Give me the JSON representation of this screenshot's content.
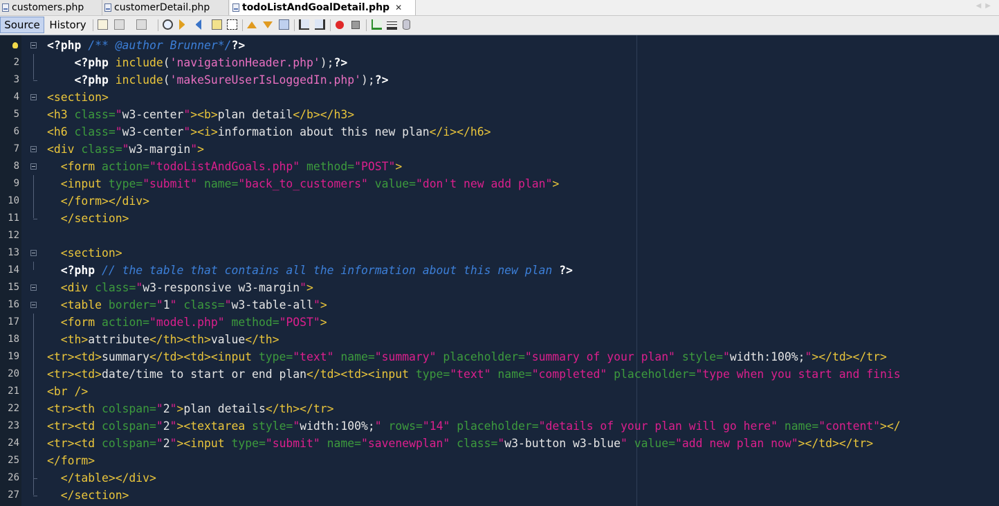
{
  "tabs": [
    {
      "label": "customers.php",
      "active": false
    },
    {
      "label": "customerDetail.php",
      "active": false
    },
    {
      "label": "todoListAndGoalDetail.php",
      "active": true
    }
  ],
  "toolbar": {
    "source_label": "Source",
    "history_label": "History",
    "icons": [
      "last-edit-icon",
      "back-icon",
      "forward-icon",
      "find-selection-icon",
      "find-previous-icon",
      "find-next-icon",
      "toggle-highlight-icon",
      "toggle-rect-select-icon",
      "previous-bookmark-icon",
      "next-bookmark-icon",
      "toggle-bookmark-icon",
      "shift-left-icon",
      "shift-right-icon",
      "start-macro-icon",
      "stop-macro-icon",
      "comment-icon",
      "uncomment-icon",
      "database-icon"
    ]
  },
  "editor": {
    "line_numbers": [
      "1",
      "2",
      "3",
      "4",
      "5",
      "6",
      "7",
      "8",
      "9",
      "10",
      "11",
      "12",
      "13",
      "14",
      "15",
      "16",
      "17",
      "18",
      "19",
      "20",
      "21",
      "22",
      "23",
      "24",
      "25",
      "26",
      "27"
    ],
    "lines": [
      [
        {
          "c": "kw",
          "t": "<?php"
        },
        {
          "c": "tx",
          "t": " "
        },
        {
          "c": "cm",
          "t": "/** @author Brunner*/"
        },
        {
          "c": "kw",
          "t": "?>"
        }
      ],
      [
        {
          "c": "tx",
          "t": "    "
        },
        {
          "c": "kw",
          "t": "<?php"
        },
        {
          "c": "tx",
          "t": " "
        },
        {
          "c": "fn",
          "t": "include"
        },
        {
          "c": "tx",
          "t": "("
        },
        {
          "c": "str",
          "t": "'navigationHeader.php'"
        },
        {
          "c": "tx",
          "t": ");"
        },
        {
          "c": "kw",
          "t": "?>"
        }
      ],
      [
        {
          "c": "tx",
          "t": "    "
        },
        {
          "c": "kw",
          "t": "<?php"
        },
        {
          "c": "tx",
          "t": " "
        },
        {
          "c": "fn",
          "t": "include"
        },
        {
          "c": "tx",
          "t": "("
        },
        {
          "c": "str",
          "t": "'makeSureUserIsLoggedIn.php'"
        },
        {
          "c": "tx",
          "t": ");"
        },
        {
          "c": "kw",
          "t": "?>"
        }
      ],
      [
        {
          "c": "tag",
          "t": "<section>"
        }
      ],
      [
        {
          "c": "tag",
          "t": "<h3"
        },
        {
          "c": "tx",
          "t": " "
        },
        {
          "c": "attr",
          "t": "class="
        },
        {
          "c": "val",
          "t": "\""
        },
        {
          "c": "tx",
          "t": "w3-center"
        },
        {
          "c": "val",
          "t": "\""
        },
        {
          "c": "tag",
          "t": "><b>"
        },
        {
          "c": "tx",
          "t": "plan detail"
        },
        {
          "c": "tag",
          "t": "</b></h3>"
        }
      ],
      [
        {
          "c": "tag",
          "t": "<h6"
        },
        {
          "c": "tx",
          "t": " "
        },
        {
          "c": "attr",
          "t": "class="
        },
        {
          "c": "val",
          "t": "\""
        },
        {
          "c": "tx",
          "t": "w3-center"
        },
        {
          "c": "val",
          "t": "\""
        },
        {
          "c": "tag",
          "t": "><i>"
        },
        {
          "c": "tx",
          "t": "information about this new plan"
        },
        {
          "c": "tag",
          "t": "</i></h6>"
        }
      ],
      [
        {
          "c": "tag",
          "t": "<div"
        },
        {
          "c": "tx",
          "t": " "
        },
        {
          "c": "attr",
          "t": "class="
        },
        {
          "c": "val",
          "t": "\""
        },
        {
          "c": "tx",
          "t": "w3-margin"
        },
        {
          "c": "val",
          "t": "\""
        },
        {
          "c": "tag",
          "t": ">"
        }
      ],
      [
        {
          "c": "tx",
          "t": "  "
        },
        {
          "c": "tag",
          "t": "<form"
        },
        {
          "c": "tx",
          "t": " "
        },
        {
          "c": "attr",
          "t": "action="
        },
        {
          "c": "val",
          "t": "\"todoListAndGoals.php\""
        },
        {
          "c": "tx",
          "t": " "
        },
        {
          "c": "attr",
          "t": "method="
        },
        {
          "c": "val",
          "t": "\"POST\""
        },
        {
          "c": "tag",
          "t": ">"
        }
      ],
      [
        {
          "c": "tx",
          "t": "  "
        },
        {
          "c": "tag",
          "t": "<input"
        },
        {
          "c": "tx",
          "t": " "
        },
        {
          "c": "attr",
          "t": "type="
        },
        {
          "c": "val",
          "t": "\"submit\""
        },
        {
          "c": "tx",
          "t": " "
        },
        {
          "c": "attr",
          "t": "name="
        },
        {
          "c": "val",
          "t": "\"back_to_customers\""
        },
        {
          "c": "tx",
          "t": " "
        },
        {
          "c": "attr",
          "t": "value="
        },
        {
          "c": "val",
          "t": "\"don't new add plan\""
        },
        {
          "c": "tag",
          "t": ">"
        }
      ],
      [
        {
          "c": "tx",
          "t": "  "
        },
        {
          "c": "tag",
          "t": "</form></div>"
        }
      ],
      [
        {
          "c": "tx",
          "t": "  "
        },
        {
          "c": "tag",
          "t": "</section>"
        }
      ],
      [],
      [
        {
          "c": "tx",
          "t": "  "
        },
        {
          "c": "tag",
          "t": "<section>"
        }
      ],
      [
        {
          "c": "tx",
          "t": "  "
        },
        {
          "c": "kw",
          "t": "<?php"
        },
        {
          "c": "tx",
          "t": " "
        },
        {
          "c": "cm",
          "t": "// the table that contains all the information about this new plan"
        },
        {
          "c": "tx",
          "t": " "
        },
        {
          "c": "kw",
          "t": "?>"
        }
      ],
      [
        {
          "c": "tx",
          "t": "  "
        },
        {
          "c": "tag",
          "t": "<div"
        },
        {
          "c": "tx",
          "t": " "
        },
        {
          "c": "attr",
          "t": "class="
        },
        {
          "c": "val",
          "t": "\""
        },
        {
          "c": "tx",
          "t": "w3-responsive w3-margin"
        },
        {
          "c": "val",
          "t": "\""
        },
        {
          "c": "tag",
          "t": ">"
        }
      ],
      [
        {
          "c": "tx",
          "t": "  "
        },
        {
          "c": "tag",
          "t": "<table"
        },
        {
          "c": "tx",
          "t": " "
        },
        {
          "c": "attr",
          "t": "border="
        },
        {
          "c": "val",
          "t": "\""
        },
        {
          "c": "tx",
          "t": "1"
        },
        {
          "c": "val",
          "t": "\""
        },
        {
          "c": "tx",
          "t": " "
        },
        {
          "c": "attr",
          "t": "class="
        },
        {
          "c": "val",
          "t": "\""
        },
        {
          "c": "tx",
          "t": "w3-table-all"
        },
        {
          "c": "val",
          "t": "\""
        },
        {
          "c": "tag",
          "t": ">"
        }
      ],
      [
        {
          "c": "tx",
          "t": "  "
        },
        {
          "c": "tag",
          "t": "<form"
        },
        {
          "c": "tx",
          "t": " "
        },
        {
          "c": "attr",
          "t": "action="
        },
        {
          "c": "val",
          "t": "\"model.php\""
        },
        {
          "c": "tx",
          "t": " "
        },
        {
          "c": "attr",
          "t": "method="
        },
        {
          "c": "val",
          "t": "\"POST\""
        },
        {
          "c": "tag",
          "t": ">"
        }
      ],
      [
        {
          "c": "tx",
          "t": "  "
        },
        {
          "c": "tag",
          "t": "<th>"
        },
        {
          "c": "tx",
          "t": "attribute"
        },
        {
          "c": "tag",
          "t": "</th><th>"
        },
        {
          "c": "tx",
          "t": "value"
        },
        {
          "c": "tag",
          "t": "</th>"
        }
      ],
      [
        {
          "c": "tag",
          "t": "<tr><td>"
        },
        {
          "c": "tx",
          "t": "summary"
        },
        {
          "c": "tag",
          "t": "</td><td><input"
        },
        {
          "c": "tx",
          "t": " "
        },
        {
          "c": "attr",
          "t": "type="
        },
        {
          "c": "val",
          "t": "\"text\""
        },
        {
          "c": "tx",
          "t": " "
        },
        {
          "c": "attr",
          "t": "name="
        },
        {
          "c": "val",
          "t": "\"summary\""
        },
        {
          "c": "tx",
          "t": " "
        },
        {
          "c": "attr",
          "t": "placeholder="
        },
        {
          "c": "val",
          "t": "\"summary of your plan\""
        },
        {
          "c": "tx",
          "t": " "
        },
        {
          "c": "attr",
          "t": "style="
        },
        {
          "c": "val",
          "t": "\""
        },
        {
          "c": "tx",
          "t": "width:100%;"
        },
        {
          "c": "val",
          "t": "\""
        },
        {
          "c": "tag",
          "t": "></td></tr>"
        }
      ],
      [
        {
          "c": "tag",
          "t": "<tr><td>"
        },
        {
          "c": "tx",
          "t": "date/time to start or end plan"
        },
        {
          "c": "tag",
          "t": "</td><td><input"
        },
        {
          "c": "tx",
          "t": " "
        },
        {
          "c": "attr",
          "t": "type="
        },
        {
          "c": "val",
          "t": "\"text\""
        },
        {
          "c": "tx",
          "t": " "
        },
        {
          "c": "attr",
          "t": "name="
        },
        {
          "c": "val",
          "t": "\"completed\""
        },
        {
          "c": "tx",
          "t": " "
        },
        {
          "c": "attr",
          "t": "placeholder="
        },
        {
          "c": "val",
          "t": "\"type when you start and finis"
        }
      ],
      [
        {
          "c": "tag",
          "t": "<br />"
        }
      ],
      [
        {
          "c": "tag",
          "t": "<tr><th"
        },
        {
          "c": "tx",
          "t": " "
        },
        {
          "c": "attr",
          "t": "colspan="
        },
        {
          "c": "val",
          "t": "\""
        },
        {
          "c": "tx",
          "t": "2"
        },
        {
          "c": "val",
          "t": "\""
        },
        {
          "c": "tag",
          "t": ">"
        },
        {
          "c": "tx",
          "t": "plan details"
        },
        {
          "c": "tag",
          "t": "</th></tr>"
        }
      ],
      [
        {
          "c": "tag",
          "t": "<tr><td"
        },
        {
          "c": "tx",
          "t": " "
        },
        {
          "c": "attr",
          "t": "colspan="
        },
        {
          "c": "val",
          "t": "\""
        },
        {
          "c": "tx",
          "t": "2"
        },
        {
          "c": "val",
          "t": "\""
        },
        {
          "c": "tag",
          "t": "><textarea"
        },
        {
          "c": "tx",
          "t": " "
        },
        {
          "c": "attr",
          "t": "style="
        },
        {
          "c": "val",
          "t": "\""
        },
        {
          "c": "tx",
          "t": "width:100%;"
        },
        {
          "c": "val",
          "t": "\""
        },
        {
          "c": "tx",
          "t": " "
        },
        {
          "c": "attr",
          "t": "rows="
        },
        {
          "c": "val",
          "t": "\"14\""
        },
        {
          "c": "tx",
          "t": " "
        },
        {
          "c": "attr",
          "t": "placeholder="
        },
        {
          "c": "val",
          "t": "\"details of your plan will go here\""
        },
        {
          "c": "tx",
          "t": " "
        },
        {
          "c": "attr",
          "t": "name="
        },
        {
          "c": "val",
          "t": "\"content\""
        },
        {
          "c": "tag",
          "t": "></"
        }
      ],
      [
        {
          "c": "tag",
          "t": "<tr><td"
        },
        {
          "c": "tx",
          "t": " "
        },
        {
          "c": "attr",
          "t": "colspan="
        },
        {
          "c": "val",
          "t": "\""
        },
        {
          "c": "tx",
          "t": "2"
        },
        {
          "c": "val",
          "t": "\""
        },
        {
          "c": "tag",
          "t": "><input"
        },
        {
          "c": "tx",
          "t": " "
        },
        {
          "c": "attr",
          "t": "type="
        },
        {
          "c": "val",
          "t": "\"submit\""
        },
        {
          "c": "tx",
          "t": " "
        },
        {
          "c": "attr",
          "t": "name="
        },
        {
          "c": "val",
          "t": "\"savenewplan\""
        },
        {
          "c": "tx",
          "t": " "
        },
        {
          "c": "attr",
          "t": "class="
        },
        {
          "c": "val",
          "t": "\""
        },
        {
          "c": "tx",
          "t": "w3-button w3-blue"
        },
        {
          "c": "val",
          "t": "\""
        },
        {
          "c": "tx",
          "t": " "
        },
        {
          "c": "attr",
          "t": "value="
        },
        {
          "c": "val",
          "t": "\"add new plan now\""
        },
        {
          "c": "tag",
          "t": "></td></tr>"
        }
      ],
      [
        {
          "c": "tag",
          "t": "</form>"
        }
      ],
      [
        {
          "c": "tx",
          "t": "  "
        },
        {
          "c": "tag",
          "t": "</table></div>"
        }
      ],
      [
        {
          "c": "tx",
          "t": "  "
        },
        {
          "c": "tag",
          "t": "</section>"
        }
      ]
    ]
  }
}
